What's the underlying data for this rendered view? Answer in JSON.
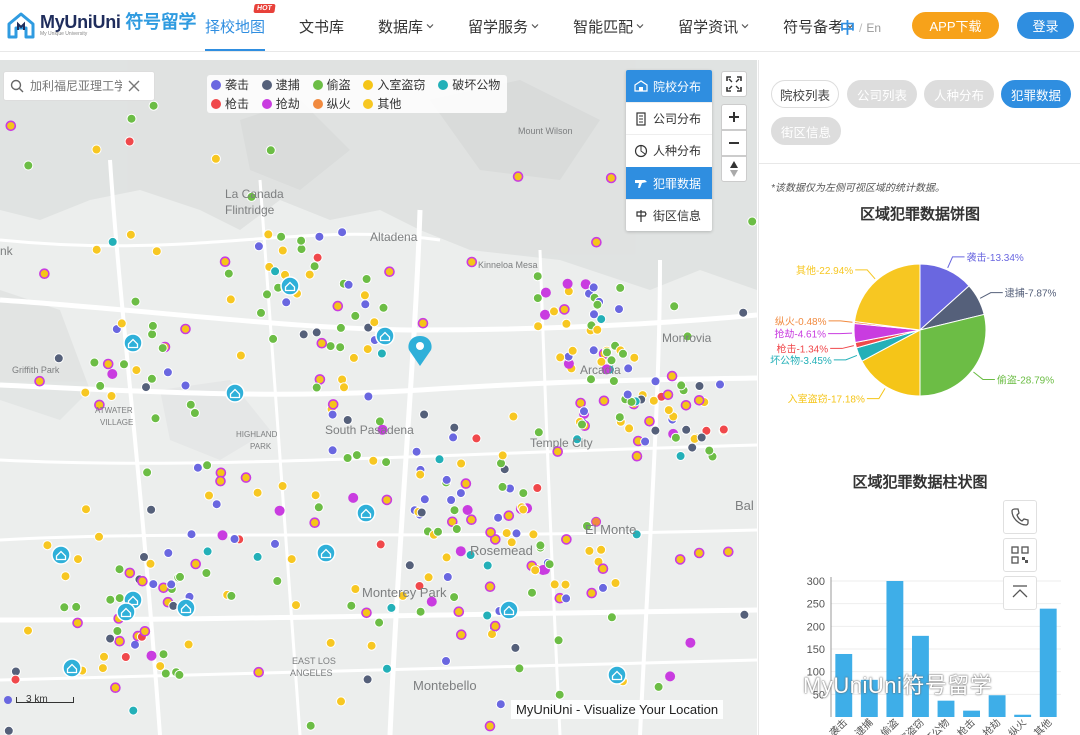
{
  "header": {
    "logo_text": "MyUniUni",
    "logo_cn": "符号留学",
    "logo_sub": "My Unique University",
    "nav": [
      {
        "label": "择校地图",
        "hot": "HOT",
        "active": true
      },
      {
        "label": "文书库"
      },
      {
        "label": "数据库",
        "dropdown": true
      },
      {
        "label": "留学服务",
        "dropdown": true
      },
      {
        "label": "智能匹配",
        "dropdown": true
      },
      {
        "label": "留学资讯",
        "dropdown": true
      },
      {
        "label": "符号备考",
        "dropdown": true
      }
    ],
    "lang_zh": "中",
    "lang_sep": "/",
    "lang_en": "En",
    "app_button": "APP下载",
    "login_button": "登录"
  },
  "map": {
    "search_placeholder": "加利福尼亚理工学院",
    "legend": [
      {
        "label": "袭击",
        "color": "#6a67e0"
      },
      {
        "label": "逮捕",
        "color": "#55607a"
      },
      {
        "label": "偷盗",
        "color": "#6cbd45"
      },
      {
        "label": "入室盗窃",
        "color": "#f5c518"
      },
      {
        "label": "破坏公物",
        "color": "#23b0b8"
      },
      {
        "label": "枪击",
        "color": "#f0484b"
      },
      {
        "label": "抢劫",
        "color": "#c93ce0"
      },
      {
        "label": "纵火",
        "color": "#f18a3f"
      },
      {
        "label": "其他",
        "color": "#f7c722"
      }
    ],
    "layers": [
      {
        "label": "院校分布",
        "icon": "school-icon",
        "active": true
      },
      {
        "label": "公司分布",
        "icon": "building-icon"
      },
      {
        "label": "人种分布",
        "icon": "ethnicity-icon"
      },
      {
        "label": "犯罪数据",
        "icon": "crime-icon",
        "active_secondary": true
      },
      {
        "label": "街区信息",
        "icon": "street-icon"
      }
    ],
    "place_labels": [
      "La Canada",
      "Flintridge",
      "Altadena",
      "Kinneloa Mesa",
      "Mount Wilson",
      "Monrovia",
      "Arcadia",
      "Griffith Park",
      "ATWATER",
      "VILLAGE",
      "HIGHLAND",
      "PARK",
      "South Pasadena",
      "Temple City",
      "El Monte",
      "Rosemead",
      "Monterey Park",
      "EAST LOS",
      "ANGELES",
      "Montebello",
      "Bal",
      "nk"
    ],
    "scale_label": "3 km",
    "attribution": "MyUniUni - Visualize Your Location"
  },
  "panel": {
    "tabs": [
      {
        "label": "院校列表",
        "state": "normal"
      },
      {
        "label": "公司列表",
        "state": "disabled"
      },
      {
        "label": "人种分布",
        "state": "disabled"
      },
      {
        "label": "犯罪数据",
        "state": "active"
      },
      {
        "label": "街区信息",
        "state": "disabled"
      }
    ],
    "note": "*该数据仅为左侧可视区域的统计数据。",
    "pie_title": "区域犯罪数据饼图",
    "bar_title": "区域犯罪数据柱状图",
    "watermark": "MyUniUni符号留学"
  },
  "chart_data": [
    {
      "type": "pie",
      "title": "区域犯罪数据饼图",
      "slices": [
        {
          "name": "袭击",
          "label": "袭击-13.34%",
          "value": 13.34,
          "color": "#6a67e0"
        },
        {
          "name": "逮捕",
          "label": "逮捕-7.87%",
          "value": 7.87,
          "color": "#55607a"
        },
        {
          "name": "偷盗",
          "label": "偷盗-28.79%",
          "value": 28.79,
          "color": "#6cbd45"
        },
        {
          "name": "入室盗窃",
          "label": "入室盗窃-17.18%",
          "value": 17.18,
          "color": "#f5c518"
        },
        {
          "name": "破坏公物",
          "label": "坏公物-3.45%",
          "value": 3.45,
          "color": "#23b0b8"
        },
        {
          "name": "枪击",
          "label": "枪击-1.34%",
          "value": 1.34,
          "color": "#f0484b"
        },
        {
          "name": "抢劫",
          "label": "抢劫-4.61%",
          "value": 4.61,
          "color": "#c93ce0"
        },
        {
          "name": "纵火",
          "label": "纵火-0.48%",
          "value": 0.48,
          "color": "#f18a3f"
        },
        {
          "name": "其他",
          "label": "其他-22.94%",
          "value": 22.94,
          "color": "#f7c722"
        }
      ]
    },
    {
      "type": "bar",
      "title": "区域犯罪数据柱状图",
      "categories": [
        "袭击",
        "逮捕",
        "偷盗",
        "入室盗窃",
        "破坏公物",
        "枪击",
        "抢劫",
        "纵火",
        "其他"
      ],
      "values": [
        139,
        82,
        300,
        179,
        36,
        14,
        48,
        5,
        239
      ],
      "yticks": [
        50,
        100,
        150,
        200,
        250,
        300
      ],
      "color": "#3eaee8"
    }
  ]
}
